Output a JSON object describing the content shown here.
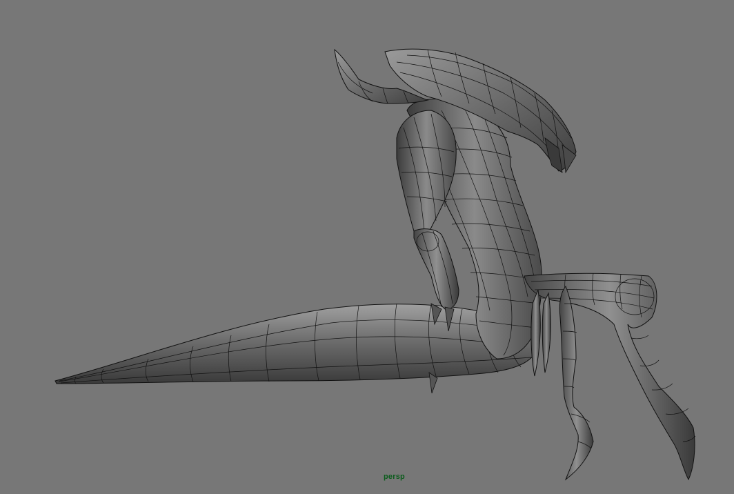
{
  "viewport": {
    "camera_label": "persp",
    "background_color": "#777777",
    "camera_label_color": "#0b5c1c",
    "display_mode": "smooth-shaded-wireframe-on-shaded",
    "model": {
      "mesh_color": "#5e5e5e",
      "highlight_color": "#a8a8a8",
      "wire_color": "#111111"
    }
  }
}
